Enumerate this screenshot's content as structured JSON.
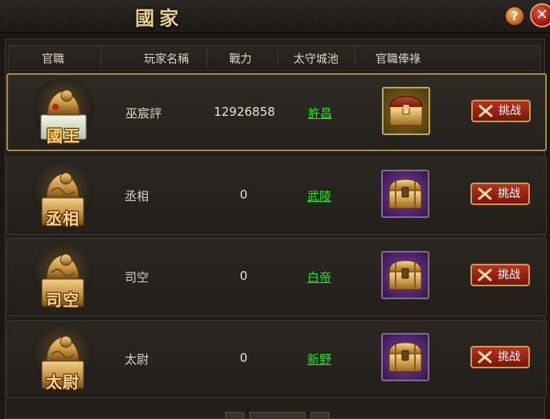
{
  "window": {
    "title": "國家",
    "help_label": "?",
    "close_label": "✕"
  },
  "table": {
    "headers": [
      "官職",
      "玩家名稱",
      "戰力",
      "太守城池",
      "官職俸祿"
    ],
    "rows": [
      {
        "rank": "國王",
        "player": "巫宸評",
        "power": "12926858",
        "city": "許昌",
        "reward_chest": "gold",
        "action_label": "挑战",
        "selected": true
      },
      {
        "rank": "丞相",
        "player": "丞相",
        "power": "0",
        "city": "武陵",
        "reward_chest": "purple",
        "action_label": "挑战",
        "selected": false
      },
      {
        "rank": "司空",
        "player": "司空",
        "power": "0",
        "city": "白帝",
        "reward_chest": "purple",
        "action_label": "挑战",
        "selected": false
      },
      {
        "rank": "太尉",
        "player": "太尉",
        "power": "0",
        "city": "新野",
        "reward_chest": "purple",
        "action_label": "挑战",
        "selected": false
      }
    ]
  },
  "colors": {
    "city_link": "#25e21a",
    "title": "#e8cf88",
    "selected_border": "#a88a46"
  }
}
